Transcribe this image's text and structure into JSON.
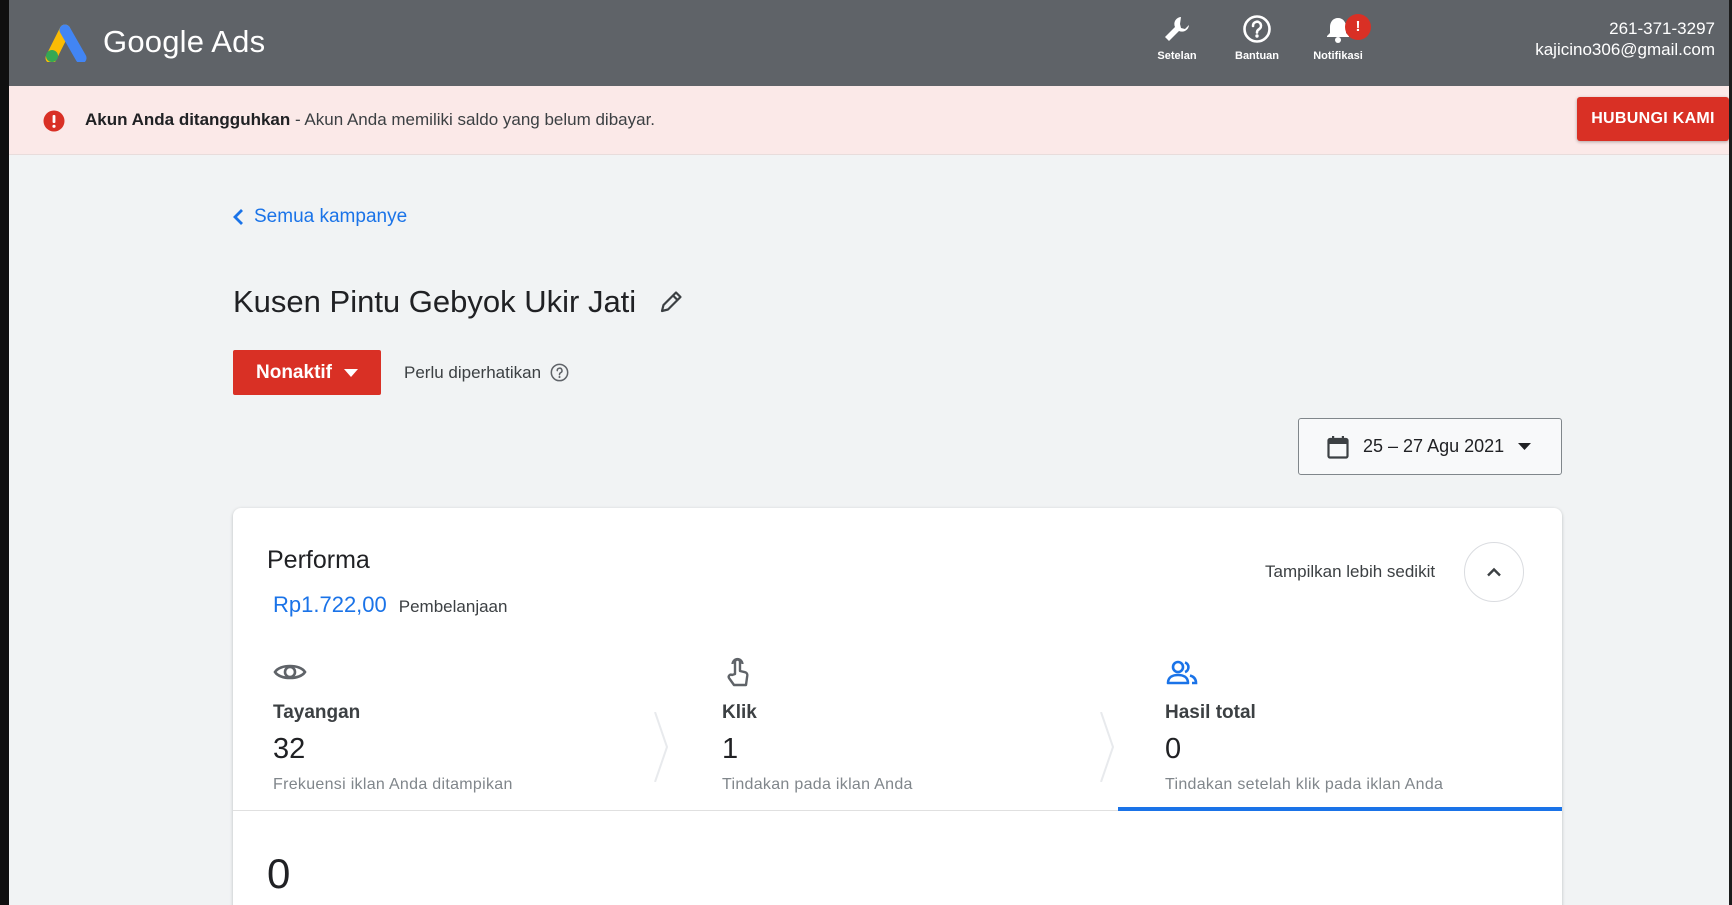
{
  "header": {
    "brand": "Google Ads",
    "tools": {
      "settings": "Setelan",
      "help": "Bantuan",
      "notifications": "Notifikasi",
      "notification_badge": "!"
    },
    "account": {
      "customer_id": "261-371-3297",
      "email": "kajicino306@gmail.com"
    }
  },
  "alert": {
    "title": "Akun Anda ditangguhkan",
    "message": " - Akun Anda memiliki saldo yang belum dibayar.",
    "button": "HUBUNGI KAMI"
  },
  "nav": {
    "back_label": "Semua kampanye"
  },
  "campaign": {
    "name": "Kusen Pintu Gebyok Ukir Jati",
    "status_label": "Nonaktif",
    "status_hint": "Perlu diperhatikan"
  },
  "date_range": {
    "label": "25 – 27 Agu 2021"
  },
  "performance": {
    "title": "Performa",
    "spend_value": "Rp1.722,00",
    "spend_label": "Pembelanjaan",
    "collapse_label": "Tampilkan lebih sedikit",
    "metrics": [
      {
        "label": "Tayangan",
        "value": "32",
        "desc": "Frekuensi iklan Anda ditampikan",
        "icon": "eye-icon"
      },
      {
        "label": "Klik",
        "value": "1",
        "desc": "Tindakan pada iklan Anda",
        "icon": "pointer-hand-icon"
      },
      {
        "label": "Hasil total",
        "value": "0",
        "desc": "Tindakan setelah klik pada iklan Anda",
        "icon": "people-icon"
      }
    ],
    "chart_value": "0"
  },
  "colors": {
    "header_bg": "#5f6368",
    "alert_bg": "#fbe9e8",
    "danger": "#d93025",
    "link": "#1a73e8"
  }
}
